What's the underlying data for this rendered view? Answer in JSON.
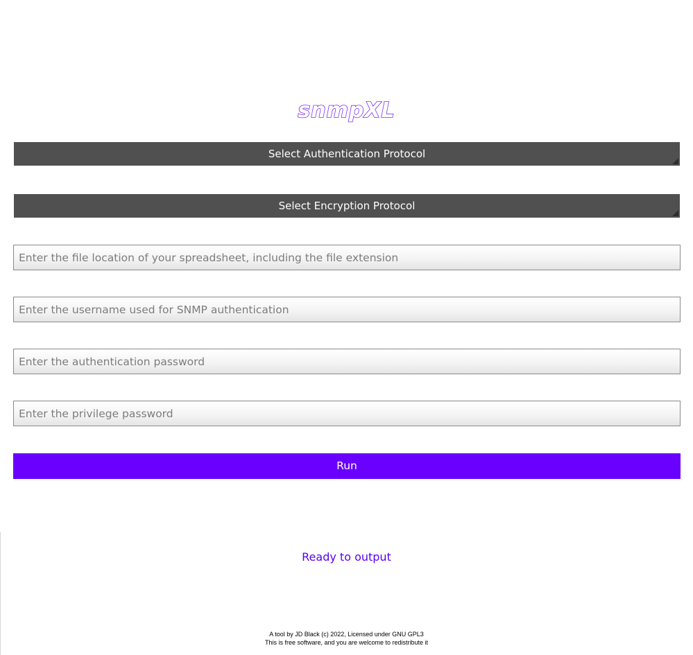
{
  "app": {
    "title": "snmpXL"
  },
  "form": {
    "auth_protocol_label": "Select Authentication Protocol",
    "enc_protocol_label": "Select Encryption Protocol",
    "file_location": {
      "value": "",
      "placeholder": "Enter the file location of your spreadsheet, including the file extension"
    },
    "username": {
      "value": "",
      "placeholder": "Enter the username used for SNMP authentication"
    },
    "auth_password": {
      "value": "",
      "placeholder": "Enter the authentication password"
    },
    "privilege_password": {
      "value": "",
      "placeholder": "Enter the privilege password"
    },
    "run_label": "Run"
  },
  "status": {
    "text": "Ready to output"
  },
  "footer": {
    "line1": "A tool by JD Black (c) 2022, Licensed under GNU GPL3",
    "line2": "This is free software, and you are welcome to redistribute it"
  },
  "colors": {
    "accent": "#6a00ff",
    "dropdown_bg": "#505050",
    "status_text": "#5a00f0"
  }
}
